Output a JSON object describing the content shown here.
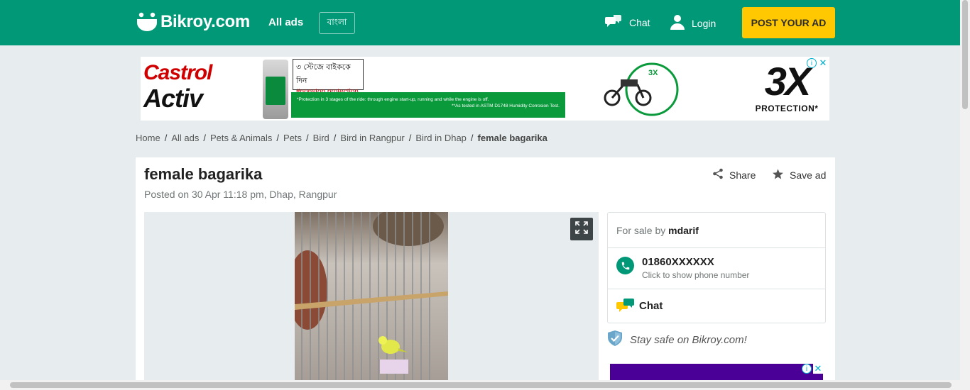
{
  "header": {
    "logo_text": "Bikroy.com",
    "all_ads": "All ads",
    "lang_label": "বাংলা",
    "chat_label": "Chat",
    "login_label": "Login",
    "post_ad_label": "POST YOUR AD",
    "brand_color": "#009877",
    "cta_color": "#ffc800"
  },
  "banner": {
    "brand_top": "Castrol",
    "brand_bottom": "Activ",
    "bengali_line": "৩ স্টেজে বাইককে দিন",
    "hashtag": "#nonstop protection",
    "fine_print_1": "*Protection in 3 stages of the ride: through engine start-up, running and while the engine is off.",
    "fine_print_2": "**As tested in ASTM D1748 Humidity Corrosion Test.",
    "badge_small": "3X",
    "badge_big": "3X",
    "badge_caption": "PROTECTION*"
  },
  "breadcrumb": {
    "items": [
      "Home",
      "All ads",
      "Pets & Animals",
      "Pets",
      "Bird",
      "Bird in Rangpur",
      "Bird in Dhap"
    ],
    "current": "female bagarika"
  },
  "listing": {
    "title": "female bagarika",
    "posted": "Posted on 30 Apr 11:18 pm, Dhap, Rangpur",
    "share_label": "Share",
    "save_label": "Save ad"
  },
  "seller": {
    "for_sale_prefix": "For sale by",
    "name": "mdarif",
    "phone": "01860XXXXXX",
    "phone_hint": "Click to show phone number",
    "chat_label": "Chat",
    "stay_safe": "Stay safe on Bikroy.com!"
  }
}
